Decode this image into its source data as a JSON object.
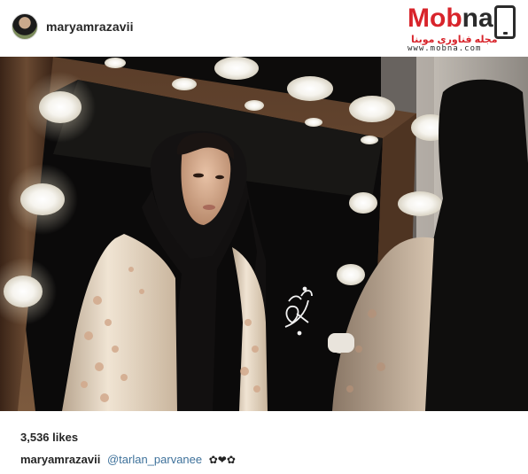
{
  "post": {
    "username": "maryamrazavii",
    "likes": "3,536 likes",
    "caption": {
      "username": "maryamrazavii",
      "mention": "@tarlan_parvanee",
      "emoji": "✿❤✿"
    }
  },
  "watermark": {
    "brand_red": "Mob",
    "brand_dark": "na",
    "subtitle": "مجله فناوری موبنا",
    "url": "www.mobna.com"
  },
  "photo": {
    "description_icon": "photo-portrait",
    "calligraphy_icon": "calligraphy-signature-icon"
  },
  "colors": {
    "brand_red": "#d8242b",
    "link_blue": "#3f729b",
    "text": "#262626"
  }
}
